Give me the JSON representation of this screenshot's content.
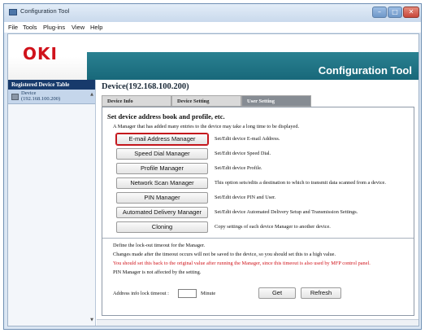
{
  "window": {
    "title": "Configuration Tool",
    "icons": {
      "minimize": "minimize-icon",
      "maximize": "maximize-icon",
      "close": "close-icon"
    }
  },
  "menu": [
    "File",
    "Tools",
    "Plug-ins",
    "View",
    "Help"
  ],
  "banner": {
    "logo": "OKI",
    "app_name": "Configuration Tool",
    "colors": {
      "logo": "#d0121b",
      "band": "#1f7384"
    }
  },
  "sidebar": {
    "header": "Registered Device Table",
    "device_name": "Device",
    "device_ip": "(192.168.100.200)"
  },
  "main": {
    "device_title": "Device(192.168.100.200)",
    "tabs": [
      "Device Info",
      "Device Setting",
      "User Setting"
    ],
    "active_tab": "User Setting",
    "section_title": "Set device address book and profile, etc.",
    "notice": "A Manager that has added many entries to the device may take a long time to be displayed.",
    "managers": [
      {
        "label": "E-mail Address Manager",
        "desc": "Set/Edit device E-mail Address."
      },
      {
        "label": "Speed Dial Manager",
        "desc": "Set/Edit device Speed Dial."
      },
      {
        "label": "Profile Manager",
        "desc": "Set/Edit device Profile."
      },
      {
        "label": "Network Scan Manager",
        "desc": "This option sets/edits a destination to which to transmit data scanned from a device."
      },
      {
        "label": "PIN Manager",
        "desc": "Set/Edit device PIN and User."
      },
      {
        "label": "Automated Delivery Manager",
        "desc": "Set/Edit device Automated Delivery Setup and Transmission Settings."
      },
      {
        "label": "Cloning",
        "desc": "Copy settings of each device Manager to another device."
      }
    ],
    "lock": {
      "line1": "Define the lock-out timeout for the Manager.",
      "line2": "Changes made after the timeout occurs will not be saved to the device, so you should set this to a high value.",
      "line3": "You should set this back to the original value after running the Manager, since this timeout is also used by MFP control panel.",
      "line4": "PIN Manager is not affected by the setting.",
      "timeout_label": "Address info lock timeout :",
      "timeout_value": "",
      "unit": "Minute",
      "get_label": "Get",
      "refresh_label": "Refresh"
    }
  }
}
